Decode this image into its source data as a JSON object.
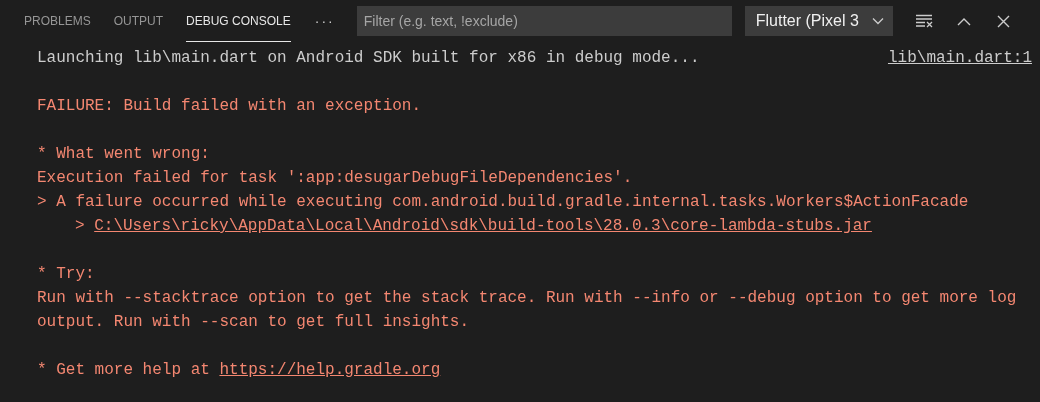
{
  "tabs": [
    {
      "label": "PROBLEMS",
      "selected": false
    },
    {
      "label": "OUTPUT",
      "selected": false
    },
    {
      "label": "DEBUG CONSOLE",
      "selected": true
    }
  ],
  "more": "···",
  "filter": {
    "placeholder": "Filter (e.g. text, !exclude)"
  },
  "session_dropdown": {
    "value": "Flutter (Pixel 3"
  },
  "console": {
    "blocks": [
      [
        {
          "kind": "info",
          "text": "Launching lib\\main.dart on Android SDK built for x86 in debug mode...",
          "source": "lib\\main.dart:1"
        }
      ],
      [
        {
          "kind": "error",
          "text": "FAILURE: Build failed with an exception."
        }
      ],
      [
        {
          "kind": "error",
          "text": "* What went wrong:"
        },
        {
          "kind": "error",
          "text": "Execution failed for task ':app:desugarDebugFileDependencies'."
        },
        {
          "kind": "error",
          "text": "> A failure occurred while executing com.android.build.gradle.internal.tasks.Workers$ActionFacade"
        },
        {
          "kind": "error",
          "indented": true,
          "text": "> ",
          "link": "C:\\Users\\ricky\\AppData\\Local\\Android\\sdk\\build-tools\\28.0.3\\core-lambda-stubs.jar"
        }
      ],
      [
        {
          "kind": "error",
          "text": "* Try:"
        },
        {
          "kind": "error",
          "text": "Run with --stacktrace option to get the stack trace. Run with --info or --debug option to get more log output. Run with --scan to get full insights."
        }
      ],
      [
        {
          "kind": "error",
          "text": "* Get more help at ",
          "link": "https://help.gradle.org"
        }
      ]
    ]
  }
}
